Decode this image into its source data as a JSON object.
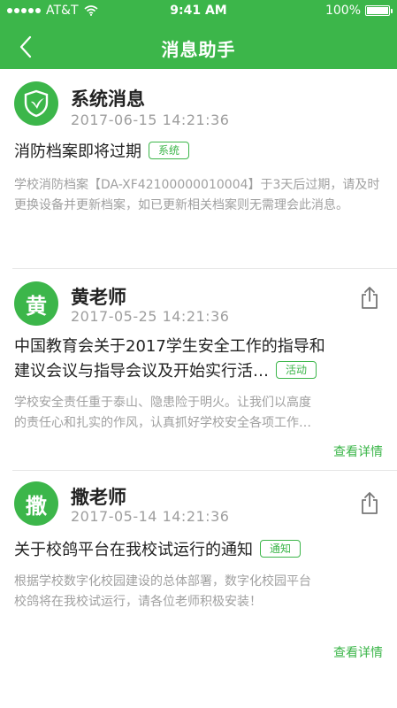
{
  "status_bar": {
    "carrier": "AT&T",
    "time": "9:41 AM",
    "battery": "100%",
    "battery_level": 1.0
  },
  "nav": {
    "title": "消息助手"
  },
  "messages": [
    {
      "sender": "系统消息",
      "time": "2017-06-15  14:21:36",
      "title": "消防档案即将过期",
      "tag": "系统",
      "body": "学校消防档案【DA-XF42100000010004】于3天后过期，请及时更换设备并更新档案，如已更新相关档案则无需理会此消息。"
    },
    {
      "sender": "黄老师",
      "avatar": "黄",
      "time": "2017-05-25  14:21:36",
      "title_line1": "中国教育会关于2017学生安全工作的指导和",
      "title_line2": "建议会议与指导会议及开始实行活…",
      "tag": "活动",
      "body_line1": "学校安全责任重于泰山、隐患险于明火。让我们以高度",
      "body_line2": "的责任心和扎实的作风，认真抓好学校安全各项工作…",
      "more": "查看详情"
    },
    {
      "sender": "撒老师",
      "avatar": "撒",
      "time": "2017-05-14  14:21:36",
      "title": "关于校鸽平台在我校试运行的通知",
      "tag": "通知",
      "body_line1": "根据学校数字化校园建设的总体部署，数字化校园平台",
      "body_line2": "校鸽将在我校试运行，请各位老师积极安装！",
      "more": "查看详情"
    }
  ],
  "colors": {
    "brand": "#3cb64a",
    "text": "#222222",
    "muted": "#a0a0a0"
  },
  "icons": {
    "back": "chevron-left-icon",
    "share": "share-icon",
    "system": "shield-icon",
    "wifi": "wifi-icon",
    "battery": "battery-icon"
  }
}
